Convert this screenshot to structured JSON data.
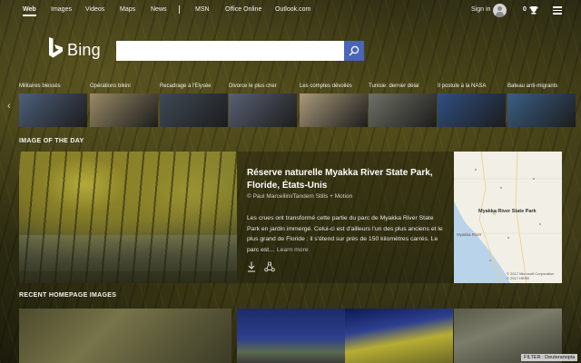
{
  "nav": {
    "links": [
      "Web",
      "Images",
      "Videos",
      "Maps",
      "News",
      "MSN",
      "Office Online",
      "Outlook.com"
    ],
    "signin": "Sign in",
    "rewards_count": "0"
  },
  "logo": {
    "text": "Bing"
  },
  "search": {
    "value": "",
    "placeholder": ""
  },
  "news": [
    {
      "label": "Militaires blessés",
      "thumb": "#4c5f7a"
    },
    {
      "label": "Opérations bikini",
      "thumb": "#9a8a66"
    },
    {
      "label": "Recadrage à l'Elysée",
      "thumb": "#3f4a55"
    },
    {
      "label": "Divorce le plus cher",
      "thumb": "#5a6072"
    },
    {
      "label": "Les comptes dévoilés",
      "thumb": "#a99a7a"
    },
    {
      "label": "Tunisie: dernier délai",
      "thumb": "#6f7066"
    },
    {
      "label": "Il postule à la NASA",
      "thumb": "#2f4f82"
    },
    {
      "label": "Bateau anti-migrants",
      "thumb": "#3b5f85"
    }
  ],
  "iotd": {
    "section_title": "IMAGE OF THE DAY",
    "title": "Réserve naturelle Myakka River State Park, Floride, États-Unis",
    "copyright": "© Paul Marcellini/Tandem Stills + Motion",
    "description": "Les crues ont transformé cette partie du parc de Myakka River State Park en jardin immergé. Celui-ci est d'ailleurs l'un des plus anciens et le plus grand de Floride : il s'étend sur près de 150 kilomètres carrés. Le parc est…",
    "learn_more": "Learn more",
    "map_label": "Myakka River State Park",
    "map_river": "Myakka River",
    "map_copyright": "© 2017 Microsoft Corporation\n© 2017 HERE"
  },
  "recent": {
    "section_title": "RECENT HOMEPAGE IMAGES"
  },
  "filter": "FILTER : Deuteranopia"
}
